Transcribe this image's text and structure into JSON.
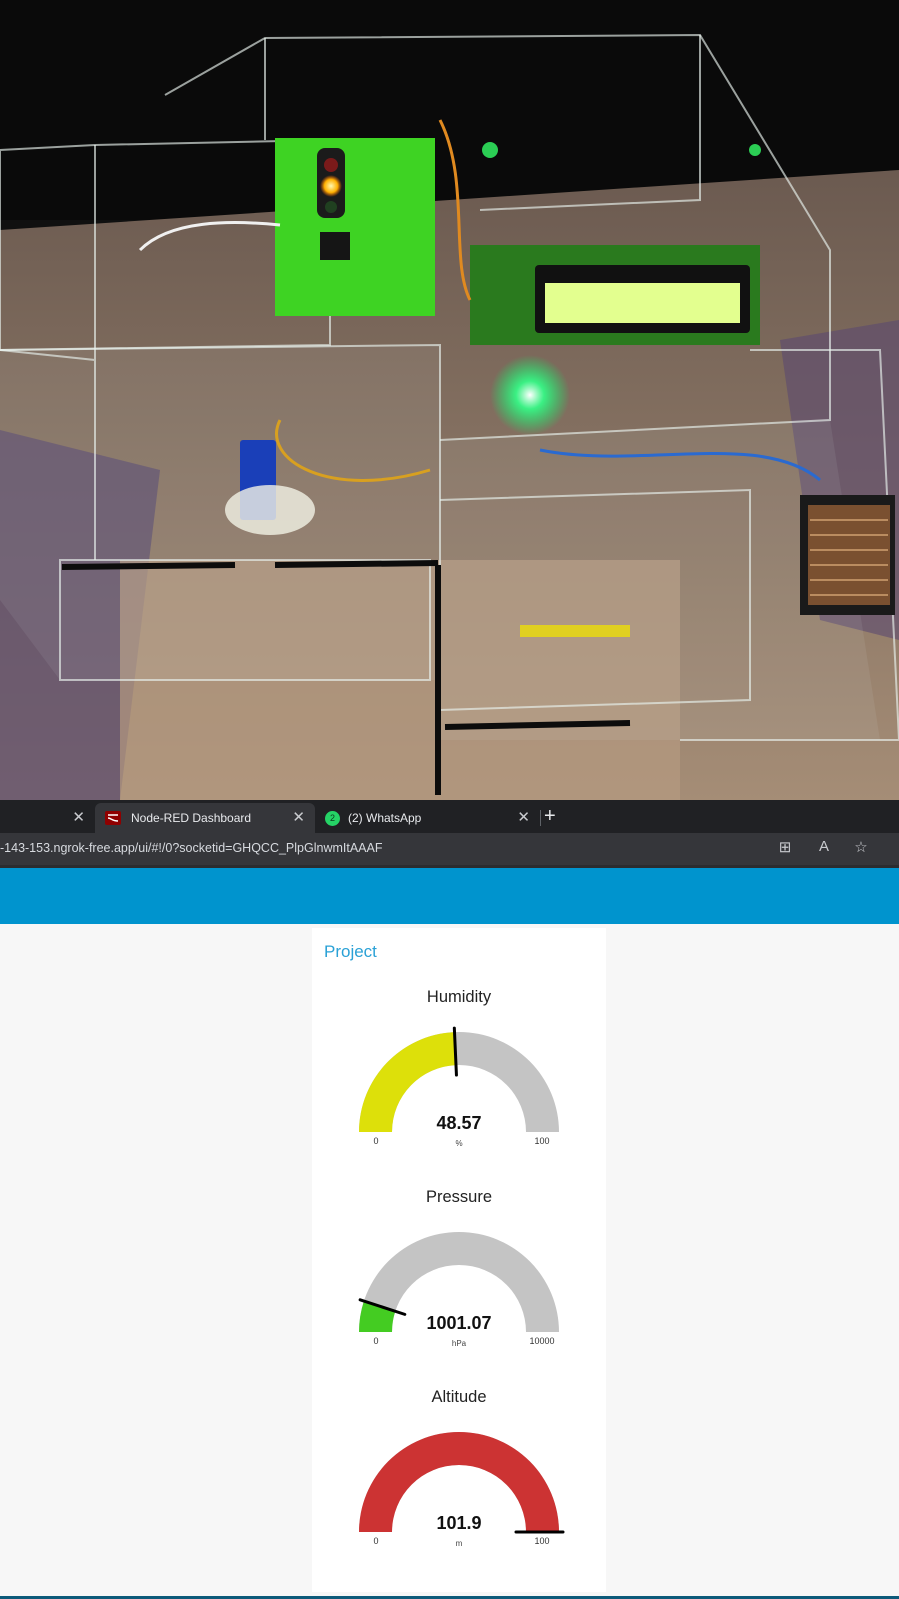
{
  "browser": {
    "tabs": [
      {
        "label": "",
        "active": false
      },
      {
        "label": "Node-RED Dashboard",
        "active": true
      },
      {
        "label": "(2) WhatsApp",
        "active": false
      }
    ],
    "address": "-143-153.ngrok-free.app/ui/#!/0?socketid=GHQCC_PlpGlnwmItAAAF",
    "whatsapp_badge": "2"
  },
  "dashboard": {
    "group_title": "Project",
    "gauges": [
      {
        "title": "Humidity",
        "value": 48.57,
        "value_label": "48.57",
        "unit": "%",
        "min": 0,
        "max": 100,
        "min_label": "0",
        "max_label": "100",
        "color": "#dde00a"
      },
      {
        "title": "Pressure",
        "value": 1001.07,
        "value_label": "1001.07",
        "unit": "hPa",
        "min": 0,
        "max": 10000,
        "min_label": "0",
        "max_label": "10000",
        "color": "#44cc22"
      },
      {
        "title": "Altitude",
        "value": 101.9,
        "value_label": "101.9",
        "unit": "m",
        "min": 0,
        "max": 100,
        "min_label": "0",
        "max_label": "100",
        "color": "#cc3333"
      }
    ]
  },
  "colors": {
    "header": "#0094ce",
    "group_title": "#2aa1d6",
    "gauge_track": "#c4c4c4"
  }
}
